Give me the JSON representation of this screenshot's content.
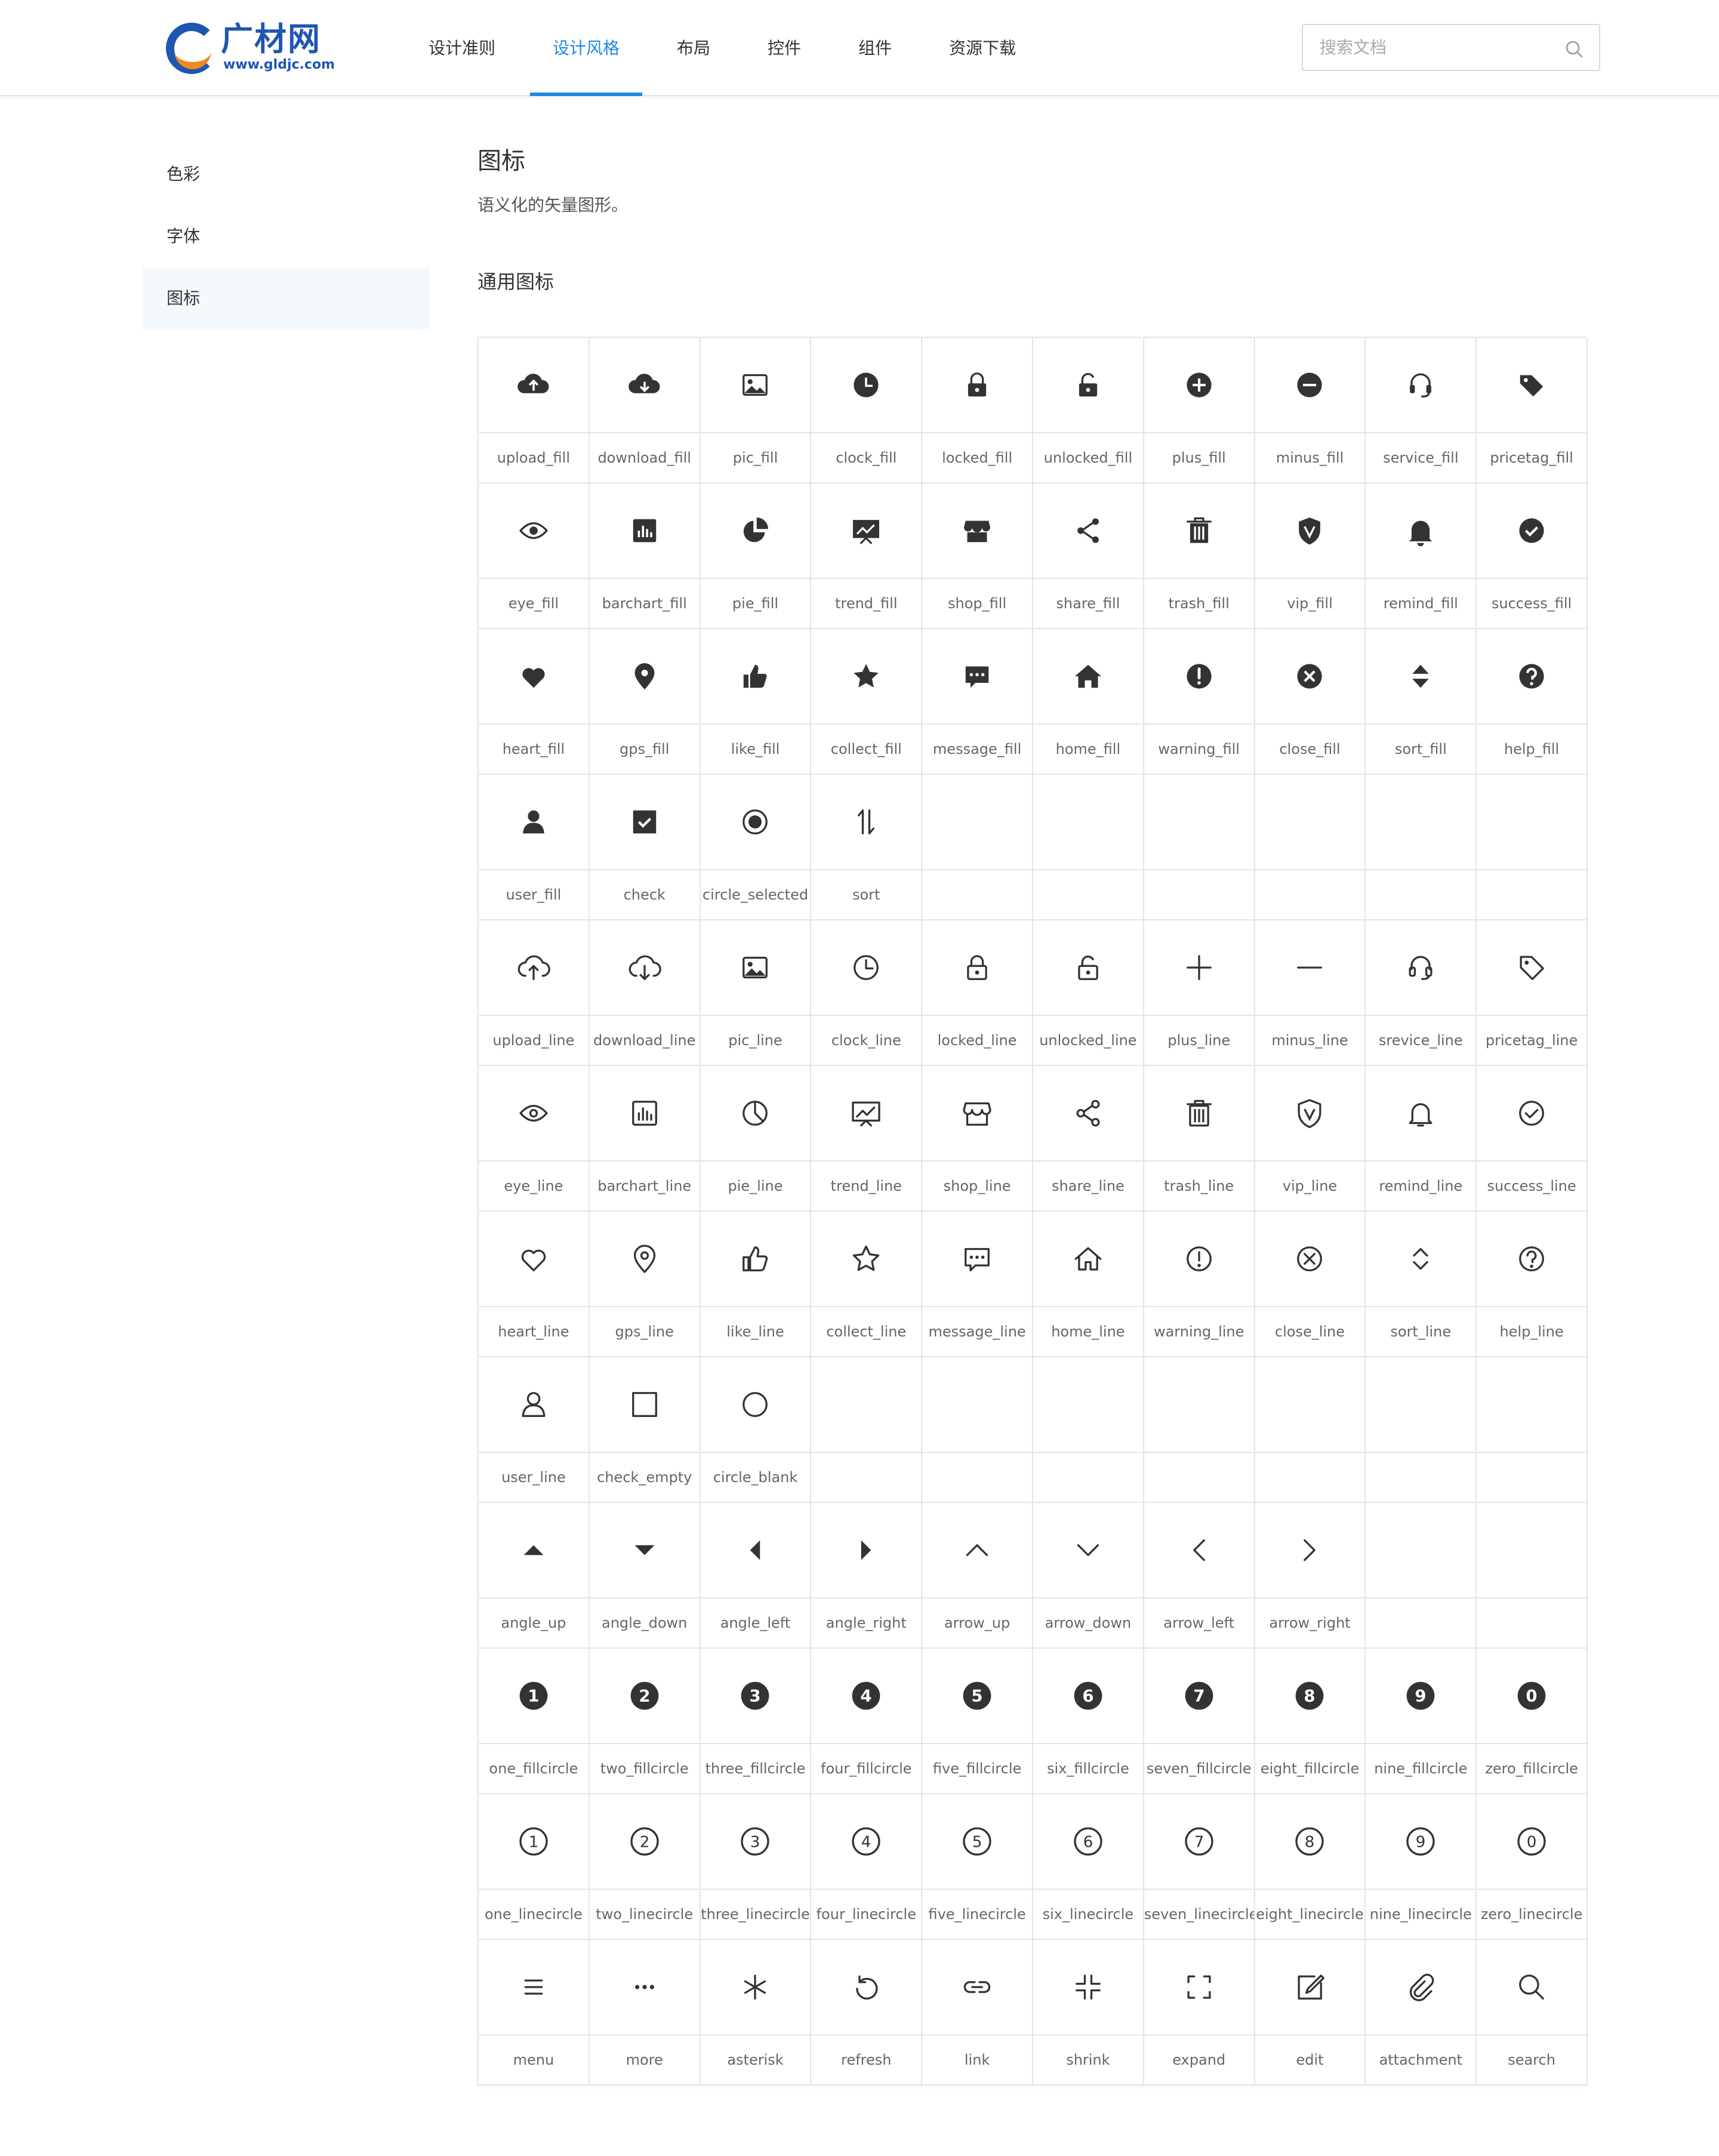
{
  "header": {
    "logo": {
      "name": "广材网",
      "url": "www.gldjc.com"
    },
    "nav": [
      "设计准则",
      "设计风格",
      "布局",
      "控件",
      "组件",
      "资源下载"
    ],
    "active_nav": 1,
    "search": {
      "placeholder": "搜索文档",
      "icon": "search-icon"
    }
  },
  "sidebar": {
    "items": [
      {
        "label": "色彩"
      },
      {
        "label": "字体"
      },
      {
        "label": "图标"
      }
    ],
    "active": 2
  },
  "main": {
    "title": "图标",
    "description": "语义化的矢量图形。",
    "section_title": "通用图标"
  },
  "colors": {
    "accent": "#1e88e5",
    "icon": "#333333",
    "border": "#e5e5e5",
    "label": "#666666"
  },
  "icons": [
    "upload_fill",
    "download_fill",
    "pic_fill",
    "clock_fill",
    "locked_fill",
    "unlocked_fill",
    "plus_fill",
    "minus_fill",
    "service_fill",
    "pricetag_fill",
    "eye_fill",
    "barchart_fill",
    "pie_fill",
    "trend_fill",
    "shop_fill",
    "share_fill",
    "trash_fill",
    "vip_fill",
    "remind_fill",
    "success_fill",
    "heart_fill",
    "gps_fill",
    "like_fill",
    "collect_fill",
    "message_fill",
    "home_fill",
    "warning_fill",
    "close_fill",
    "sort_fill",
    "help_fill",
    "user_fill",
    "check",
    "circle_selected",
    "sort",
    "",
    "",
    "",
    "",
    "",
    "",
    "upload_line",
    "download_line",
    "pic_line",
    "clock_line",
    "locked_line",
    "unlocked_line",
    "plus_line",
    "minus_line",
    "srevice_line",
    "pricetag_line",
    "eye_line",
    "barchart_line",
    "pie_line",
    "trend_line",
    "shop_line",
    "share_line",
    "trash_line",
    "vip_line",
    "remind_line",
    "success_line",
    "heart_line",
    "gps_line",
    "like_line",
    "collect_line",
    "message_line",
    "home_line",
    "warning_line",
    "close_line",
    "sort_line",
    "help_line",
    "user_line",
    "check_empty",
    "circle_blank",
    "",
    "",
    "",
    "",
    "",
    "",
    "",
    "angle_up",
    "angle_down",
    "angle_left",
    "angle_right",
    "arrow_up",
    "arrow_down",
    "arrow_left",
    "arrow_right",
    "",
    "",
    "one_fillcircle",
    "two_fillcircle",
    "three_fillcircle",
    "four_fillcircle",
    "five_fillcircle",
    "six_fillcircle",
    "seven_fillcircle",
    "eight_fillcircle",
    "nine_fillcircle",
    "zero_fillcircle",
    "one_linecircle",
    "two_linecircle",
    "three_linecircle",
    "four_linecircle",
    "five_linecircle",
    "six_linecircle",
    "seven_linecircle",
    "eight_linecircle",
    "nine_linecircle",
    "zero_linecircle",
    "menu",
    "more",
    "asterisk",
    "refresh",
    "link",
    "shrink",
    "expand",
    "edit",
    "attachment",
    "search"
  ]
}
